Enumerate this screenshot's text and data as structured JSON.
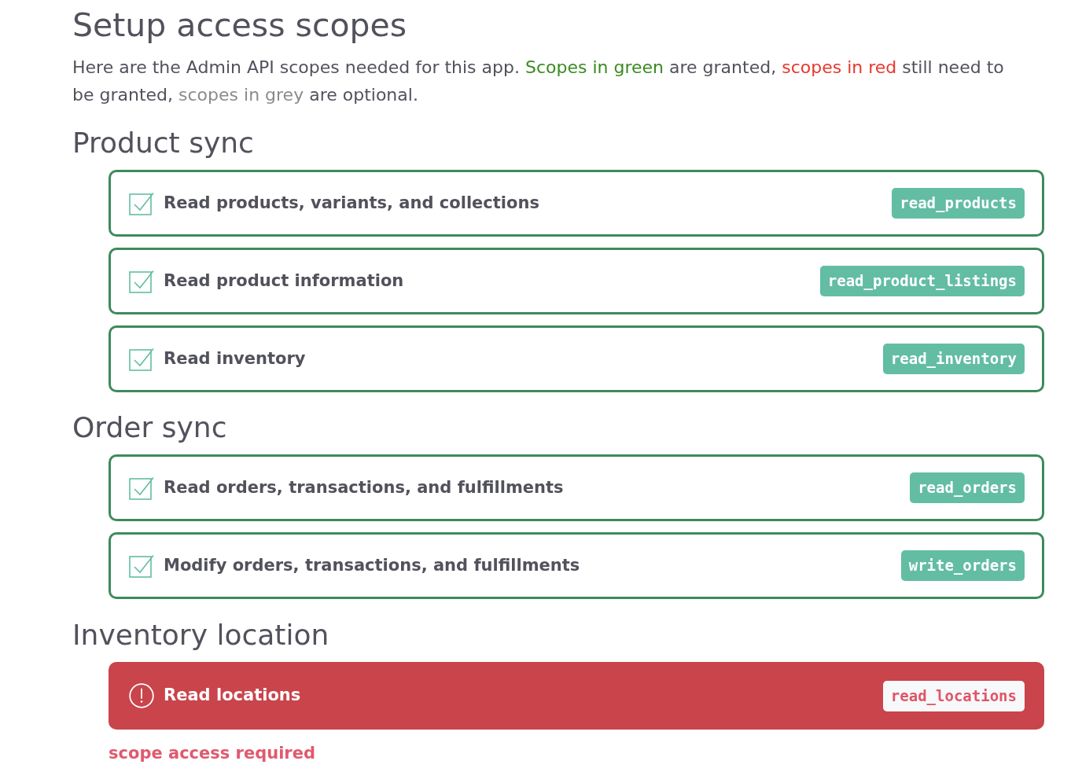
{
  "title": "Setup access scopes",
  "intro": [
    {
      "kind": "plain",
      "text": "Here are the Admin API scopes needed for this app. "
    },
    {
      "kind": "granted",
      "text": "Scopes in green"
    },
    {
      "kind": "plain",
      "text": " are granted, "
    },
    {
      "kind": "required",
      "text": "scopes in red"
    },
    {
      "kind": "plain",
      "text": " still need to be granted, "
    },
    {
      "kind": "optional",
      "text": "scopes in grey"
    },
    {
      "kind": "plain",
      "text": " are optional."
    }
  ],
  "sections": [
    {
      "heading": "Product sync",
      "scopes": [
        {
          "label": "Read products, variants, and collections",
          "scope": "read_products",
          "granted": true
        },
        {
          "label": "Read product information",
          "scope": "read_product_listings",
          "granted": true
        },
        {
          "label": "Read inventory",
          "scope": "read_inventory",
          "granted": true
        }
      ]
    },
    {
      "heading": "Order sync",
      "scopes": [
        {
          "label": "Read orders, transactions, and fulfillments",
          "scope": "read_orders",
          "granted": true
        },
        {
          "label": "Modify orders, transactions, and fulfillments",
          "scope": "write_orders",
          "granted": true
        }
      ]
    },
    {
      "heading": "Inventory location",
      "scopes": [
        {
          "label": "Read locations",
          "scope": "read_locations",
          "granted": false,
          "error": "scope access required"
        }
      ]
    }
  ]
}
